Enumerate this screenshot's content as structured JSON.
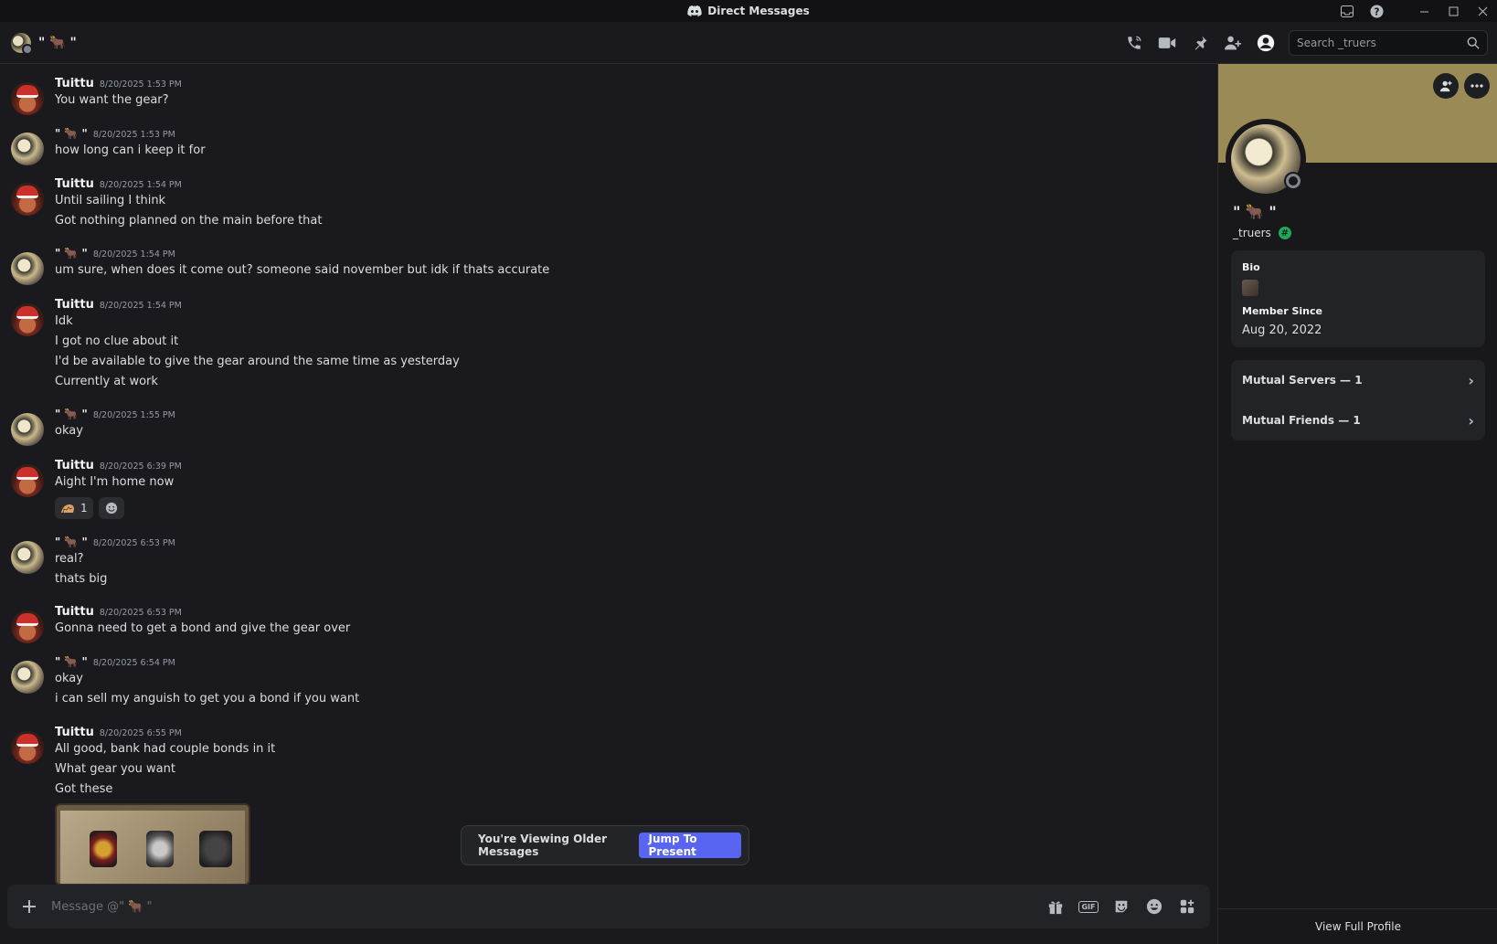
{
  "window": {
    "title": "Direct Messages"
  },
  "header": {
    "name": "\" 🐂 \"",
    "search_placeholder": "Search _truers"
  },
  "messages": [
    {
      "author": "Tuittu",
      "time": "8/20/2025 1:53 PM",
      "lines": [
        "You want the gear?"
      ]
    },
    {
      "author": "\" 🐂 \"",
      "time": "8/20/2025 1:53 PM",
      "lines": [
        "how long can i keep it for"
      ]
    },
    {
      "author": "Tuittu",
      "time": "8/20/2025 1:54 PM",
      "lines": [
        "Until sailing I think",
        "Got nothing planned on the main before that"
      ]
    },
    {
      "author": "\" 🐂 \"",
      "time": "8/20/2025 1:54 PM",
      "lines": [
        "um sure, when does it come out? someone said november but idk if thats accurate"
      ]
    },
    {
      "author": "Tuittu",
      "time": "8/20/2025 1:54 PM",
      "lines": [
        "Idk",
        "I got no clue about it",
        "I'd be available to give the gear around the same time as yesterday",
        "Currently at work"
      ]
    },
    {
      "author": "\" 🐂 \"",
      "time": "8/20/2025 1:55 PM",
      "lines": [
        "okay"
      ]
    },
    {
      "author": "Tuittu",
      "time": "8/20/2025 6:39 PM",
      "lines": [
        "Aight I'm home now"
      ],
      "reaction_count": "1"
    },
    {
      "author": "\" 🐂 \"",
      "time": "8/20/2025 6:53 PM",
      "lines": [
        "real?",
        "thats big"
      ]
    },
    {
      "author": "Tuittu",
      "time": "8/20/2025 6:53 PM",
      "lines": [
        "Gonna need to get a bond and give the gear over"
      ]
    },
    {
      "author": "\" 🐂 \"",
      "time": "8/20/2025 6:54 PM",
      "lines": [
        "okay",
        "i can sell my anguish to get you a bond if you want"
      ]
    },
    {
      "author": "Tuittu",
      "time": "8/20/2025 6:55 PM",
      "lines": [
        "All good, bank had couple bonds in it",
        "What gear you want",
        "Got these"
      ]
    }
  ],
  "older_bar": {
    "text": "You're Viewing Older Messages",
    "button": "Jump To Present"
  },
  "composer": {
    "placeholder": "Message @\" 🐂 \""
  },
  "profile": {
    "display_name": "\" 🐂 \"",
    "handle": "_truers",
    "bio_label": "Bio",
    "member_since_label": "Member Since",
    "member_since": "Aug 20, 2022",
    "mutual_servers": "Mutual Servers — 1",
    "mutual_friends": "Mutual Friends — 1",
    "view_full": "View Full Profile"
  },
  "colors": {
    "accent": "#5865f2",
    "banner": "#9a8a55",
    "status_online_badge": "#23a55a"
  }
}
